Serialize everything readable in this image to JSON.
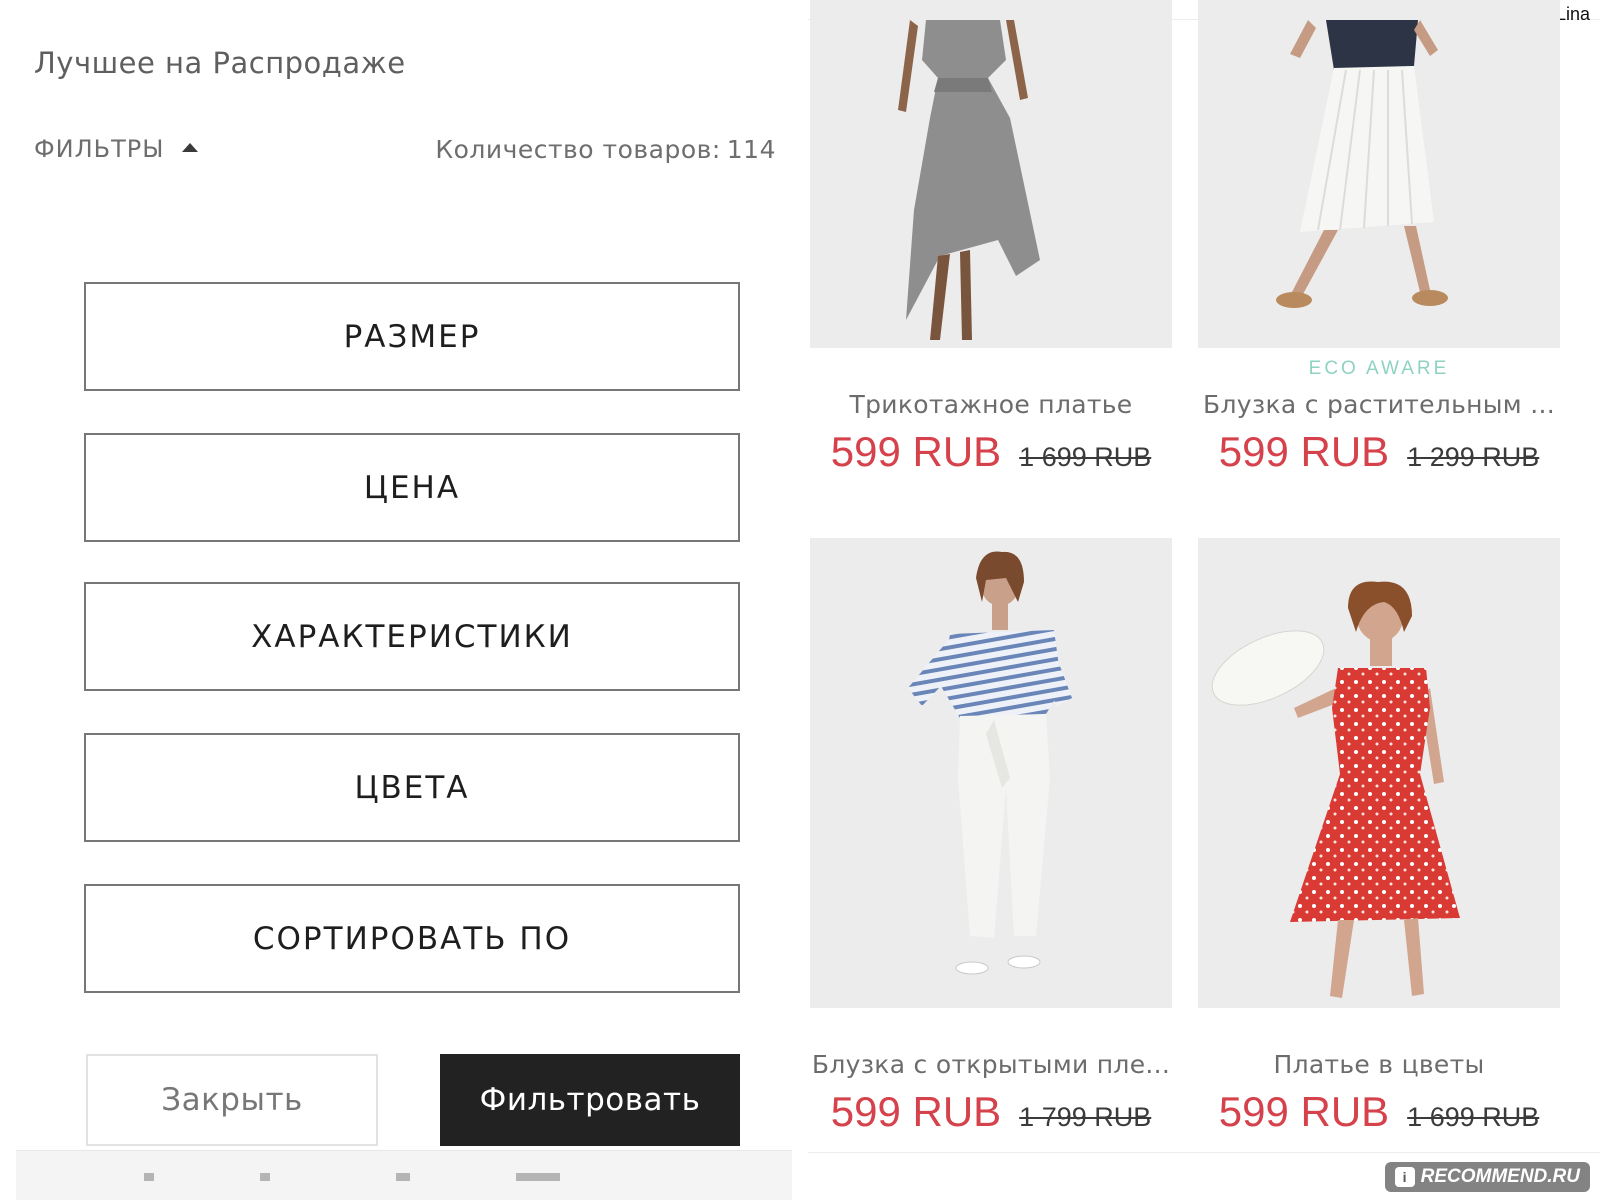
{
  "page": {
    "title": "Лучшее на Распродаже",
    "filters_label": "ФИЛЬТРЫ",
    "count_label": "Количество товаров:",
    "count_value": "114"
  },
  "filters": {
    "size": "РАЗМЕР",
    "price": "ЦЕНА",
    "features": "ХАРАКТЕРИСТИКИ",
    "colors": "ЦВЕТА",
    "sort": "СОРТИРОВАТЬ ПО"
  },
  "actions": {
    "close": "Закрыть",
    "apply": "Фильтровать"
  },
  "watermarks": {
    "author": "OlinaLina",
    "site": "RECOMMEND.RU"
  },
  "products": [
    {
      "name": "Трикотажное платье",
      "price": "599 RUB",
      "old_price": "1 699 RUB",
      "badge": ""
    },
    {
      "name": "Блузка с растительным ...",
      "price": "599 RUB",
      "old_price": "1 299 RUB",
      "badge": "ECO AWARE"
    },
    {
      "name": "Блузка с открытыми пле...",
      "price": "599 RUB",
      "old_price": "1 799 RUB",
      "badge": ""
    },
    {
      "name": "Платье в цветы",
      "price": "599 RUB",
      "old_price": "1 699 RUB",
      "badge": ""
    }
  ],
  "colors": {
    "sale_price": "#d5424b",
    "eco_badge": "#8ed2c2",
    "apply_button": "#222222"
  }
}
